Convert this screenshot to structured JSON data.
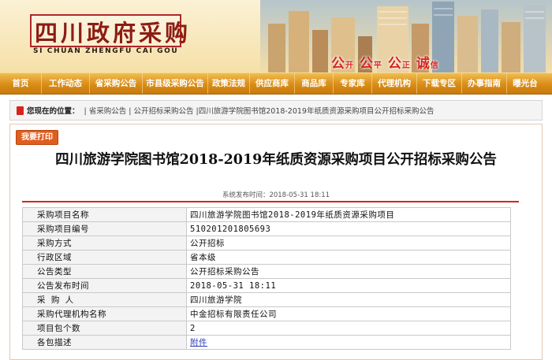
{
  "header": {
    "site_title": "四川政府采购",
    "site_subtitle": "SI CHUAN ZHENGFU CAI GOU",
    "slogan": {
      "c1": "公",
      "s1": "开",
      "c2": "公",
      "s2": "平",
      "c3": "公",
      "s3": "正",
      "c4": "诚",
      "s4": "信"
    }
  },
  "nav": {
    "items": [
      "首页",
      "工作动态",
      "省采购公告",
      "市县级采购公告",
      "政策法规",
      "供应商库",
      "商品库",
      "专家库",
      "代理机构",
      "下载专区",
      "办事指南",
      "曝光台"
    ]
  },
  "breadcrumb": {
    "label": "您现在的位置：",
    "path": "| 省采购公告 | 公开招标采购公告 |四川旅游学院图书馆2018-2019年纸质资源采购项目公开招标采购公告"
  },
  "article": {
    "print_label": "我要打印",
    "title": "四川旅游学院图书馆2018-2019年纸质资源采购项目公开招标采购公告",
    "publish_time": "系统发布时间：2018-05-31 18:11"
  },
  "info_table": {
    "rows": [
      {
        "key": "采购项目名称",
        "value": "四川旅游学院图书馆2018-2019年纸质资源采购项目"
      },
      {
        "key": "采购项目编号",
        "value": "510201201805693"
      },
      {
        "key": "采购方式",
        "value": "公开招标"
      },
      {
        "key": "行政区域",
        "value": "省本级"
      },
      {
        "key": "公告类型",
        "value": "公开招标采购公告"
      },
      {
        "key": "公告发布时间",
        "value": "2018-05-31 18:11"
      },
      {
        "key": "采 购 人",
        "value": "四川旅游学院"
      },
      {
        "key": "采购代理机构名称",
        "value": "中金招标有限责任公司"
      },
      {
        "key": "项目包个数",
        "value": "2"
      },
      {
        "key": "各包描述",
        "value": "附件"
      }
    ]
  },
  "colors": {
    "brand_red": "#d7241c",
    "nav_orange": "#d98d17",
    "print_button": "#e05e1e",
    "link_blue": "#2a3fbf"
  }
}
